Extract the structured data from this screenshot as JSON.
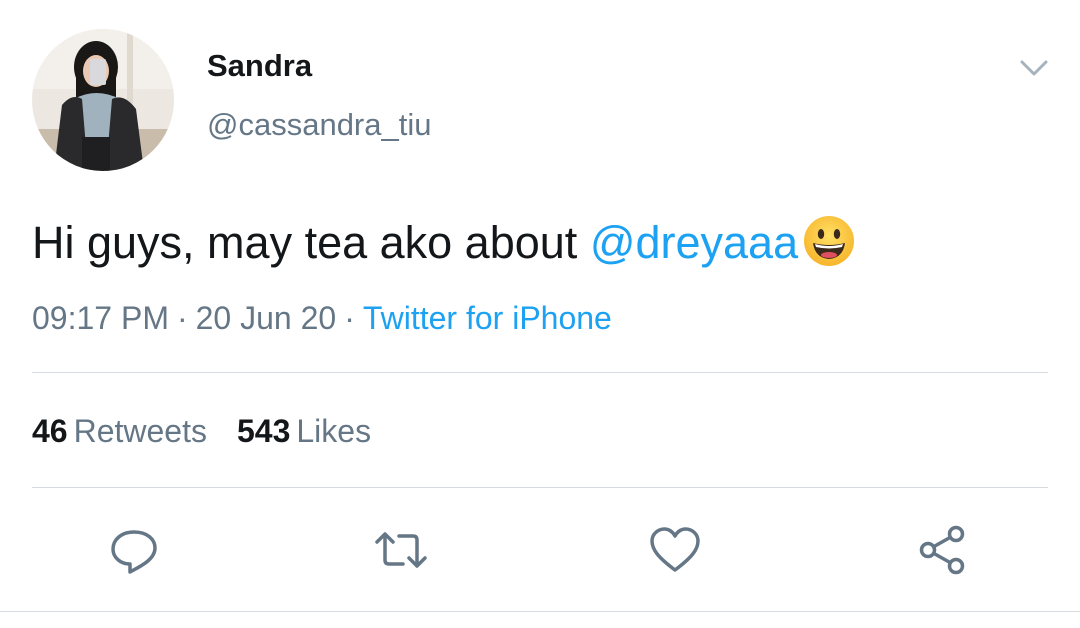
{
  "user": {
    "display_name": "Sandra",
    "handle": "@cassandra_tiu",
    "avatar_icon": "profile-photo"
  },
  "tweet": {
    "text": "Hi guys, may tea ako about ",
    "mention": "@dreyaaa",
    "emoji": "grinning-face-emoji",
    "time": "09:17 PM",
    "date": "20 Jun 20",
    "separator": "·",
    "source": "Twitter for iPhone"
  },
  "stats": {
    "retweets_count": "46",
    "retweets_label": "Retweets",
    "likes_count": "543",
    "likes_label": "Likes"
  },
  "actions": {
    "reply_icon": "reply-icon",
    "retweet_icon": "retweet-icon",
    "like_icon": "heart-icon",
    "share_icon": "share-icon"
  },
  "colors": {
    "accent": "#1da1f2",
    "text": "#14171a",
    "secondary": "#657786",
    "divider": "#d5dbe0"
  }
}
